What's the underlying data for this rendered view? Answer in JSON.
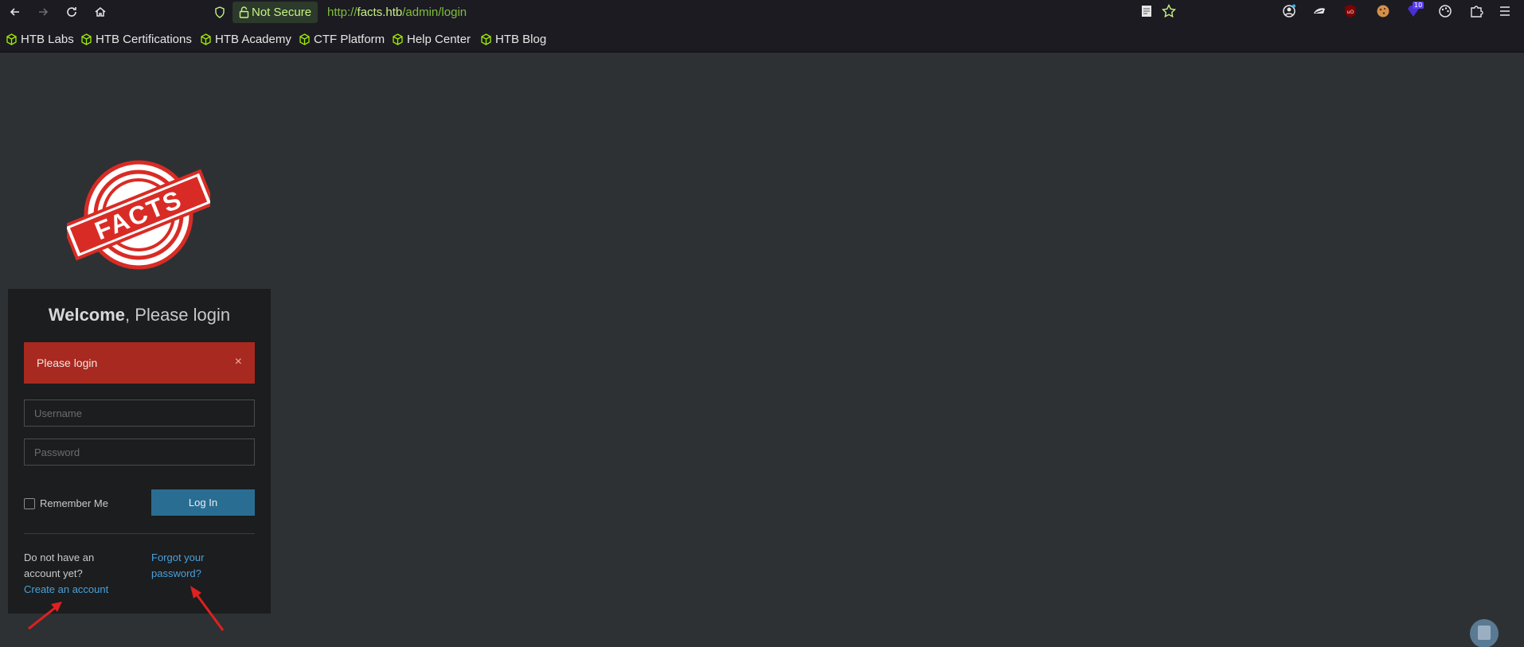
{
  "browser": {
    "security_label": "Not Secure",
    "url_prefix": "http://",
    "url_host": "facts.htb",
    "url_path": "/admin/login",
    "extension_badge": "10",
    "accent_color": "#c7f284"
  },
  "bookmarks": [
    {
      "label": "HTB Labs"
    },
    {
      "label": "HTB Certifications"
    },
    {
      "label": "HTB Academy"
    },
    {
      "label": "CTF Platform"
    },
    {
      "label": "Help Center"
    },
    {
      "label": "HTB Blog"
    }
  ],
  "logo": {
    "text": "FACTS"
  },
  "login": {
    "title_bold": "Welcome",
    "title_rest": ", Please login",
    "alert_text": "Please login",
    "alert_close": "×",
    "username_placeholder": "Username",
    "password_placeholder": "Password",
    "remember_label": "Remember Me",
    "login_button": "Log In",
    "no_account_text": "Do not have an account yet?",
    "create_account_link": "Create an account",
    "forgot_password_link": "Forgot your password?"
  },
  "colors": {
    "alert_bg": "#a8291f",
    "button_bg": "#2a6d92",
    "link": "#4aa0d8",
    "annotation_arrow": "#e02020"
  }
}
